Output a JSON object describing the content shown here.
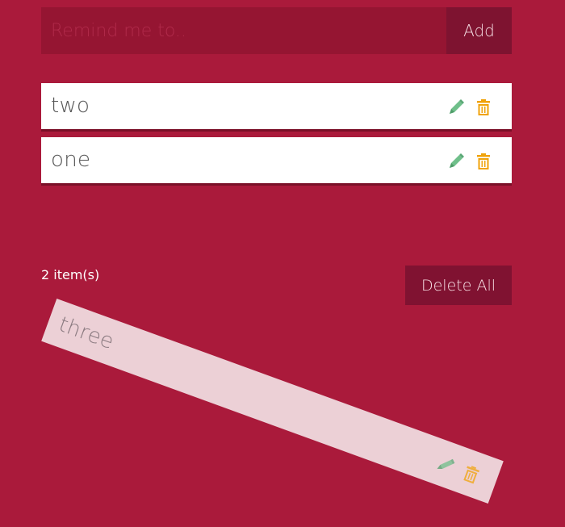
{
  "add_form": {
    "placeholder": "Remind me to..",
    "input_value": "",
    "add_label": "Add"
  },
  "items": [
    {
      "text": "two",
      "edit_icon": "pencil-icon",
      "delete_icon": "trash-icon"
    },
    {
      "text": "one",
      "edit_icon": "pencil-icon",
      "delete_icon": "trash-icon"
    }
  ],
  "dragging_item": {
    "text": "three",
    "edit_icon": "pencil-icon",
    "delete_icon": "trash-icon"
  },
  "footer": {
    "count_label": "2 item(s)",
    "delete_all_label": "Delete All"
  },
  "colors": {
    "background": "#aa1a3b",
    "input_bg": "#951532",
    "button_bg": "#7e1330",
    "item_bg": "#ffffff",
    "edit_icon": "#6fbf8a",
    "delete_icon": "#f0a30a"
  }
}
